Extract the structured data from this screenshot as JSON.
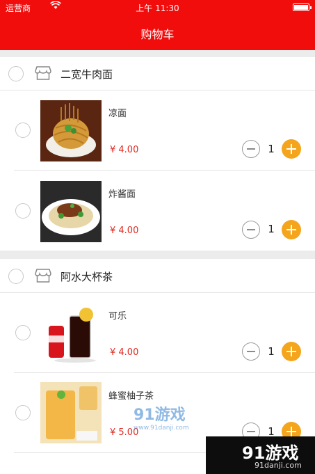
{
  "status_bar": {
    "carrier": "运营商",
    "time": "上午 11:30"
  },
  "nav": {
    "title": "购物车"
  },
  "stores": [
    {
      "name": "二宽牛肉面",
      "items": [
        {
          "name": "凉面",
          "price": "¥ 4.00",
          "qty": "1",
          "image": "cold-noodles"
        },
        {
          "name": "炸酱面",
          "price": "¥ 4.00",
          "qty": "1",
          "image": "zhajiang-noodles"
        }
      ]
    },
    {
      "name": "阿水大杯茶",
      "items": [
        {
          "name": "可乐",
          "price": "¥ 4.00",
          "qty": "1",
          "image": "cola"
        },
        {
          "name": "蜂蜜柚子茶",
          "price": "¥ 5.00",
          "qty": "1",
          "image": "honey-citron-tea"
        }
      ]
    }
  ],
  "watermark": {
    "center": "91游戏",
    "center_sub": "www.91danji.com",
    "corner": "91游戏",
    "corner_sub": "91danji.com"
  },
  "colors": {
    "nav_bg": "#f20d0d",
    "price": "#e0291f",
    "plus_button": "#f4a51c"
  }
}
